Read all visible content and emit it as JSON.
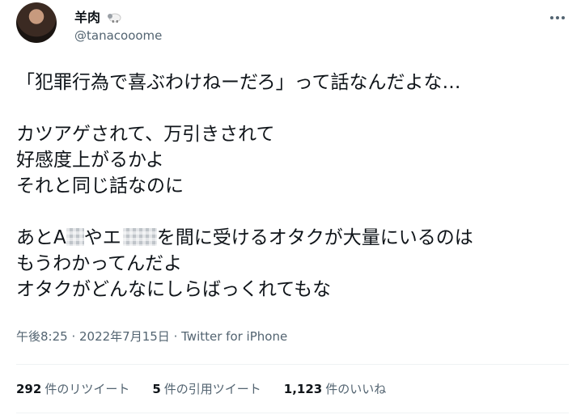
{
  "author": {
    "display_name": "羊肉",
    "name_emoji": "sheep-emoji",
    "handle": "@tanacooome"
  },
  "tweet": {
    "lines": [
      "「犯罪行為で喜ぶわけねーだろ」って話なんだよな…",
      "",
      "カツアゲされて、万引きされて",
      "好感度上がるかよ",
      "それと同じ話なのに",
      "",
      {
        "before": "あとA",
        "mid": "やエ",
        "after": "を間に受けるオタクが大量にいるのは"
      },
      "もうわかってんだよ",
      "オタクがどんなにしらばっくれてもな"
    ]
  },
  "meta": {
    "time": "午後8:25",
    "separator": " · ",
    "date": "2022年7月15日",
    "separator2": " · ",
    "source": "Twitter for iPhone"
  },
  "stats": {
    "retweets_count": "292",
    "retweets_label": "件のリツイート",
    "quotes_count": "5",
    "quotes_label": "件の引用ツイート",
    "likes_count": "1,123",
    "likes_label": "件のいいね"
  },
  "icons": {
    "more": "more-horizontal-icon"
  }
}
